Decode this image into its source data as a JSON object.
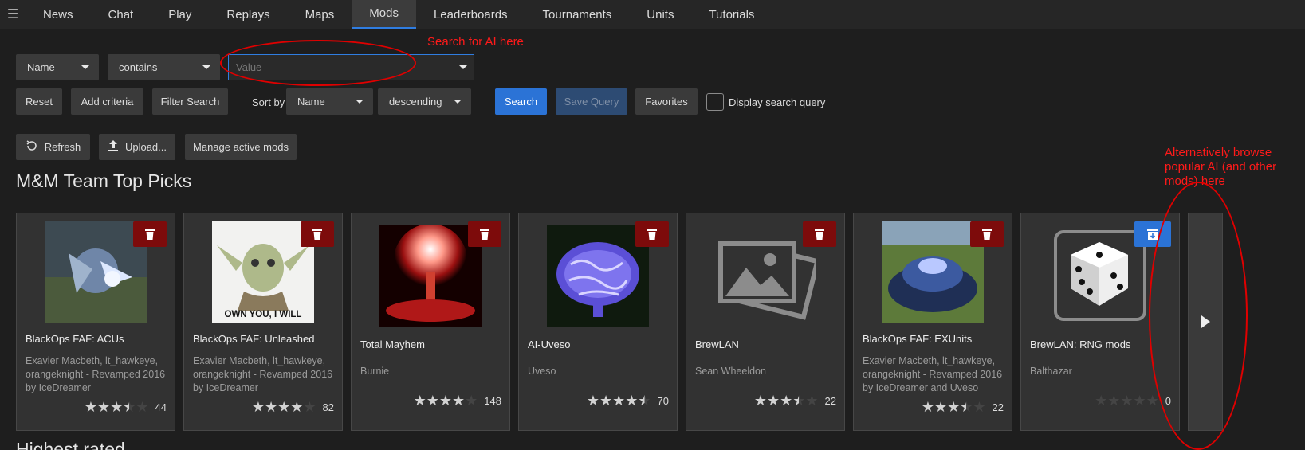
{
  "nav": {
    "menu_icon": "hamburger-icon",
    "tabs": [
      "News",
      "Chat",
      "Play",
      "Replays",
      "Maps",
      "Mods",
      "Leaderboards",
      "Tournaments",
      "Units",
      "Tutorials"
    ],
    "active_tab": "Mods",
    "accent_color": "#2f7de1"
  },
  "search": {
    "field": "Name",
    "operator": "contains",
    "value_placeholder": "Value",
    "reset": "Reset",
    "add_criteria": "Add criteria",
    "filter_search": "Filter Search",
    "sort_by_label": "Sort by",
    "sort_field": "Name",
    "sort_order": "descending",
    "search_button": "Search",
    "save_query": "Save Query",
    "favorites": "Favorites",
    "display_query_label": "Display search query",
    "display_query_checked": false
  },
  "actions": {
    "refresh": "Refresh",
    "upload": "Upload...",
    "manage": "Manage active mods"
  },
  "annotations": {
    "search_hint": "Search for AI here",
    "browse_hint_line1": "Alternatively browse",
    "browse_hint_line2": "popular AI (and other",
    "browse_hint_line3": "mods) here",
    "color": "#ff1a1a"
  },
  "section_title": "M&M Team Top Picks",
  "next_section_title": "Highest rated",
  "mods": [
    {
      "name": "BlackOps FAF: ACUs",
      "authors": "Exavier Macbeth, lt_hawkeye, orangeknight - Revamped 2016 by IceDreamer",
      "rating": 3.5,
      "count": "44",
      "installed": true,
      "thumb_icon": "mech-thumbnail"
    },
    {
      "name": "BlackOps FAF: Unleashed",
      "authors": "Exavier Macbeth, lt_hawkeye, orangeknight - Revamped 2016 by IceDreamer",
      "rating": 4.0,
      "count": "82",
      "installed": true,
      "thumb_icon": "yoda-thumbnail",
      "thumb_caption": "OWN YOU, I WILL"
    },
    {
      "name": "Total Mayhem",
      "authors": "Burnie",
      "rating": 4.0,
      "count": "148",
      "installed": true,
      "thumb_icon": "explosion-thumbnail"
    },
    {
      "name": "AI-Uveso",
      "authors": "Uveso",
      "rating": 4.5,
      "count": "70",
      "installed": true,
      "thumb_icon": "brain-thumbnail"
    },
    {
      "name": "BrewLAN",
      "authors": "Sean Wheeldon",
      "rating": 3.5,
      "count": "22",
      "installed": true,
      "thumb_icon": "image-placeholder-icon"
    },
    {
      "name": "BlackOps FAF: EXUnits",
      "authors": "Exavier Macbeth, lt_hawkeye, orangeknight - Revamped 2016 by IceDreamer and Uveso",
      "rating": 3.5,
      "count": "22",
      "installed": true,
      "thumb_icon": "structure-thumbnail"
    },
    {
      "name": "BrewLAN: RNG mods",
      "authors": "Balthazar",
      "rating": 0,
      "count": "0",
      "installed": false,
      "thumb_icon": "dice-icon"
    }
  ]
}
